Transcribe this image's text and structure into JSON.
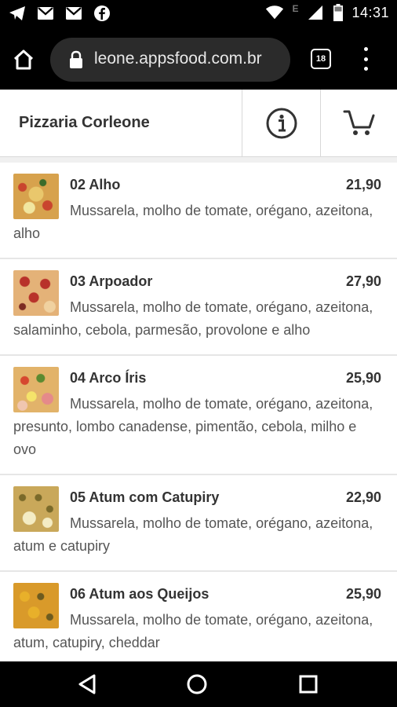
{
  "status_bar": {
    "time": "14:31",
    "icons": [
      "telegram-icon",
      "gmail-icon",
      "gmail-icon",
      "facebook-icon",
      "wifi-icon",
      "signal-icon",
      "battery-icon"
    ],
    "network_label": "E"
  },
  "browser": {
    "url": "leone.appsfood.com.br",
    "tab_count": "18"
  },
  "header": {
    "title": "Pizzaria Corleone"
  },
  "menu": {
    "items": [
      {
        "name": "02 Alho",
        "price": "21,90",
        "description": "Mussarela, molho de tomate, orégano, azeitona, alho"
      },
      {
        "name": "03 Arpoador",
        "price": "27,90",
        "description": "Mussarela, molho de tomate, orégano, azeitona, salaminho, cebola, parmesão, provolone e alho"
      },
      {
        "name": "04 Arco Íris",
        "price": "25,90",
        "description": "Mussarela, molho de tomate, orégano, azeitona, presunto, lombo canadense, pimentão, cebola, milho e ovo"
      },
      {
        "name": "05 Atum com Catupiry",
        "price": "22,90",
        "description": "Mussarela, molho de tomate, orégano, azeitona, atum e catupiry"
      },
      {
        "name": "06 Atum aos Queijos",
        "price": "25,90",
        "description": "Mussarela, molho de tomate, orégano, azeitona, atum, catupiry, cheddar"
      }
    ]
  },
  "colors": {
    "header_bg": "#ffffff",
    "list_bg": "#f0f0f0",
    "chrome_bg": "#000000",
    "url_bar_bg": "#2b2b2b"
  }
}
